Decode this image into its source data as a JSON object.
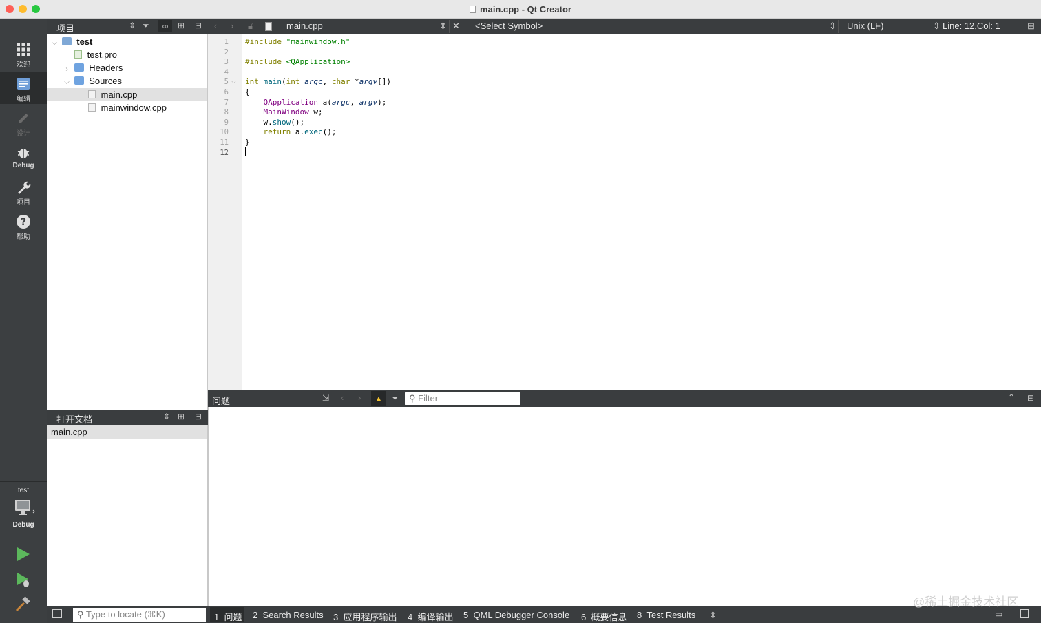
{
  "window": {
    "title": "main.cpp - Qt Creator",
    "traffic_colors": {
      "close": "#fe5f57",
      "minimize": "#febc2e",
      "zoom": "#28c840"
    }
  },
  "modebar": {
    "modes": [
      {
        "label": "欢迎",
        "icon": "grid-icon"
      },
      {
        "label": "编辑",
        "icon": "edit-doc-icon"
      },
      {
        "label": "设计",
        "icon": "pencil-icon"
      },
      {
        "label": "Debug",
        "icon": "bug-icon"
      },
      {
        "label": "项目",
        "icon": "wrench-icon"
      },
      {
        "label": "帮助",
        "icon": "help-icon"
      }
    ],
    "kit": {
      "project": "test",
      "build": "Debug"
    }
  },
  "project_pane": {
    "title": "项目",
    "tree": [
      {
        "label": "test",
        "level": 0,
        "expanded": true,
        "icon": "project-icon"
      },
      {
        "label": "test.pro",
        "level": 1,
        "icon": "pro-file-icon"
      },
      {
        "label": "Headers",
        "level": 1,
        "expanded": false,
        "icon": "folder-icon"
      },
      {
        "label": "Sources",
        "level": 1,
        "expanded": true,
        "icon": "folder-icon"
      },
      {
        "label": "main.cpp",
        "level": 2,
        "icon": "cpp-file-icon",
        "selected": true
      },
      {
        "label": "mainwindow.cpp",
        "level": 2,
        "icon": "cpp-file-icon"
      }
    ]
  },
  "open_docs": {
    "title": "打开文档",
    "items": [
      "main.cpp"
    ]
  },
  "editor_toolbar": {
    "file": "main.cpp",
    "symbol": "<Select Symbol>",
    "line_ending": "Unix (LF)",
    "position": "Line: 12,Col: 1"
  },
  "editor": {
    "line_numbers": [
      "1",
      "2",
      "3",
      "4",
      "5",
      "6",
      "7",
      "8",
      "9",
      "10",
      "11",
      "12"
    ],
    "current_line": 12,
    "lines": [
      [
        {
          "t": "#include ",
          "c": "kw"
        },
        {
          "t": "\"mainwindow.h\"",
          "c": "str"
        }
      ],
      [],
      [
        {
          "t": "#include ",
          "c": "kw"
        },
        {
          "t": "<QApplication>",
          "c": "str"
        }
      ],
      [],
      [
        {
          "t": "int ",
          "c": "kw"
        },
        {
          "t": "main",
          "c": "fn"
        },
        {
          "t": "("
        },
        {
          "t": "int ",
          "c": "kw"
        },
        {
          "t": "argc",
          "c": "it"
        },
        {
          "t": ", "
        },
        {
          "t": "char ",
          "c": "kw"
        },
        {
          "t": "*"
        },
        {
          "t": "argv",
          "c": "it"
        },
        {
          "t": "[])"
        }
      ],
      [
        {
          "t": "{"
        }
      ],
      [
        {
          "t": "    "
        },
        {
          "t": "QApplication ",
          "c": "ty"
        },
        {
          "t": "a"
        },
        {
          "t": "("
        },
        {
          "t": "argc",
          "c": "it"
        },
        {
          "t": ", "
        },
        {
          "t": "argv",
          "c": "it"
        },
        {
          "t": ");"
        }
      ],
      [
        {
          "t": "    "
        },
        {
          "t": "MainWindow ",
          "c": "ty"
        },
        {
          "t": "w;"
        }
      ],
      [
        {
          "t": "    "
        },
        {
          "t": "w.",
          "c": ""
        },
        {
          "t": "show",
          "c": "fn"
        },
        {
          "t": "();"
        }
      ],
      [
        {
          "t": "    "
        },
        {
          "t": "return ",
          "c": "kw"
        },
        {
          "t": "a.",
          "c": ""
        },
        {
          "t": "exec",
          "c": "fn"
        },
        {
          "t": "();"
        }
      ],
      [
        {
          "t": "}"
        }
      ],
      []
    ]
  },
  "issues_pane": {
    "title": "问题",
    "filter_placeholder": "Filter"
  },
  "statusbar": {
    "locator_placeholder": "Type to locate (⌘K)",
    "tabs": [
      {
        "num": "1",
        "label": "问题"
      },
      {
        "num": "2",
        "label": "Search Results"
      },
      {
        "num": "3",
        "label": "应用程序输出"
      },
      {
        "num": "4",
        "label": "编译输出"
      },
      {
        "num": "5",
        "label": "QML Debugger Console"
      },
      {
        "num": "6",
        "label": "概要信息"
      },
      {
        "num": "8",
        "label": "Test Results"
      }
    ]
  },
  "watermark": "@稀土掘金技术社区"
}
